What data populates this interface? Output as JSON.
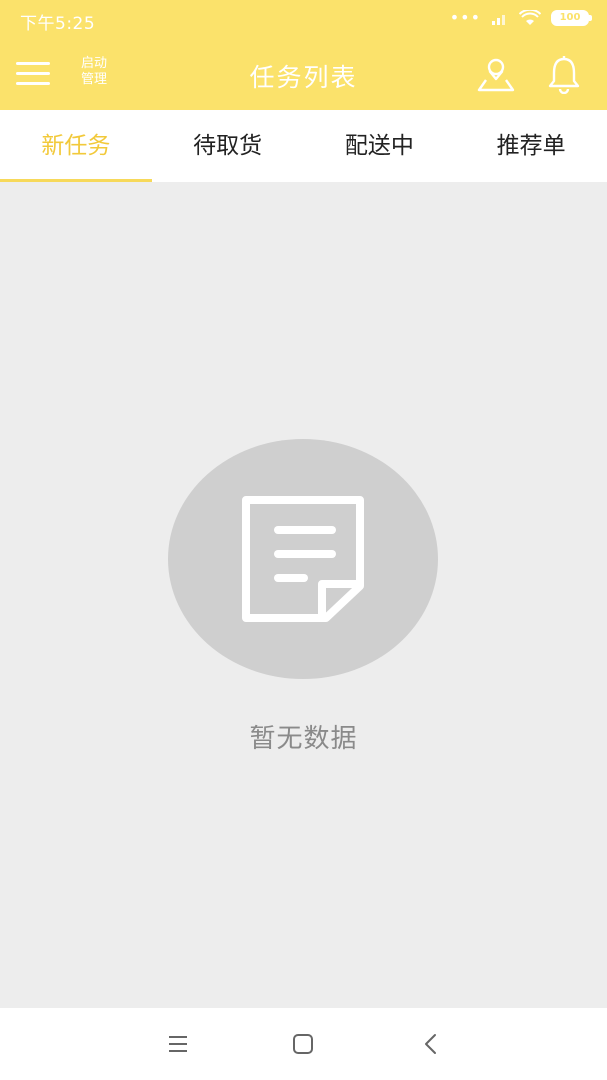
{
  "status_bar": {
    "time": "下午5:25",
    "battery": "100"
  },
  "header": {
    "admin_label": "启动管理",
    "title": "任务列表"
  },
  "tabs": [
    {
      "label": "新任务",
      "active": true
    },
    {
      "label": "待取货",
      "active": false
    },
    {
      "label": "配送中",
      "active": false
    },
    {
      "label": "推荐单",
      "active": false
    }
  ],
  "empty_state": {
    "message": "暂无数据"
  },
  "icons": {
    "menu": "menu-icon",
    "location": "location-person-icon",
    "bell": "bell-icon",
    "document": "document-icon",
    "nav_menu": "menu-lines-icon",
    "nav_home": "square-home-icon",
    "nav_back": "back-chevron-icon"
  },
  "colors": {
    "brand_yellow": "#fbe26b",
    "active_tab": "#f2c93a",
    "background": "#ededed",
    "empty_circle": "#cfcfcf"
  }
}
